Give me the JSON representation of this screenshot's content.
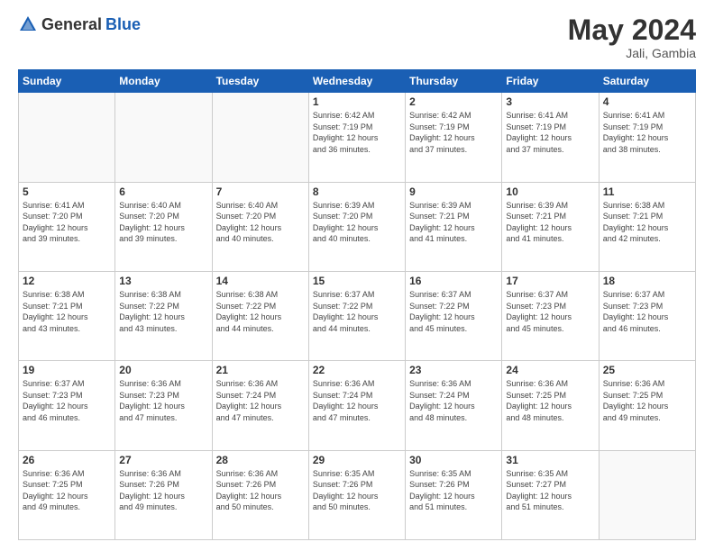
{
  "header": {
    "logo_general": "General",
    "logo_blue": "Blue",
    "month_title": "May 2024",
    "location": "Jali, Gambia"
  },
  "days_of_week": [
    "Sunday",
    "Monday",
    "Tuesday",
    "Wednesday",
    "Thursday",
    "Friday",
    "Saturday"
  ],
  "weeks": [
    [
      {
        "day": "",
        "info": ""
      },
      {
        "day": "",
        "info": ""
      },
      {
        "day": "",
        "info": ""
      },
      {
        "day": "1",
        "info": "Sunrise: 6:42 AM\nSunset: 7:19 PM\nDaylight: 12 hours\nand 36 minutes."
      },
      {
        "day": "2",
        "info": "Sunrise: 6:42 AM\nSunset: 7:19 PM\nDaylight: 12 hours\nand 37 minutes."
      },
      {
        "day": "3",
        "info": "Sunrise: 6:41 AM\nSunset: 7:19 PM\nDaylight: 12 hours\nand 37 minutes."
      },
      {
        "day": "4",
        "info": "Sunrise: 6:41 AM\nSunset: 7:19 PM\nDaylight: 12 hours\nand 38 minutes."
      }
    ],
    [
      {
        "day": "5",
        "info": "Sunrise: 6:41 AM\nSunset: 7:20 PM\nDaylight: 12 hours\nand 39 minutes."
      },
      {
        "day": "6",
        "info": "Sunrise: 6:40 AM\nSunset: 7:20 PM\nDaylight: 12 hours\nand 39 minutes."
      },
      {
        "day": "7",
        "info": "Sunrise: 6:40 AM\nSunset: 7:20 PM\nDaylight: 12 hours\nand 40 minutes."
      },
      {
        "day": "8",
        "info": "Sunrise: 6:39 AM\nSunset: 7:20 PM\nDaylight: 12 hours\nand 40 minutes."
      },
      {
        "day": "9",
        "info": "Sunrise: 6:39 AM\nSunset: 7:21 PM\nDaylight: 12 hours\nand 41 minutes."
      },
      {
        "day": "10",
        "info": "Sunrise: 6:39 AM\nSunset: 7:21 PM\nDaylight: 12 hours\nand 41 minutes."
      },
      {
        "day": "11",
        "info": "Sunrise: 6:38 AM\nSunset: 7:21 PM\nDaylight: 12 hours\nand 42 minutes."
      }
    ],
    [
      {
        "day": "12",
        "info": "Sunrise: 6:38 AM\nSunset: 7:21 PM\nDaylight: 12 hours\nand 43 minutes."
      },
      {
        "day": "13",
        "info": "Sunrise: 6:38 AM\nSunset: 7:22 PM\nDaylight: 12 hours\nand 43 minutes."
      },
      {
        "day": "14",
        "info": "Sunrise: 6:38 AM\nSunset: 7:22 PM\nDaylight: 12 hours\nand 44 minutes."
      },
      {
        "day": "15",
        "info": "Sunrise: 6:37 AM\nSunset: 7:22 PM\nDaylight: 12 hours\nand 44 minutes."
      },
      {
        "day": "16",
        "info": "Sunrise: 6:37 AM\nSunset: 7:22 PM\nDaylight: 12 hours\nand 45 minutes."
      },
      {
        "day": "17",
        "info": "Sunrise: 6:37 AM\nSunset: 7:23 PM\nDaylight: 12 hours\nand 45 minutes."
      },
      {
        "day": "18",
        "info": "Sunrise: 6:37 AM\nSunset: 7:23 PM\nDaylight: 12 hours\nand 46 minutes."
      }
    ],
    [
      {
        "day": "19",
        "info": "Sunrise: 6:37 AM\nSunset: 7:23 PM\nDaylight: 12 hours\nand 46 minutes."
      },
      {
        "day": "20",
        "info": "Sunrise: 6:36 AM\nSunset: 7:23 PM\nDaylight: 12 hours\nand 47 minutes."
      },
      {
        "day": "21",
        "info": "Sunrise: 6:36 AM\nSunset: 7:24 PM\nDaylight: 12 hours\nand 47 minutes."
      },
      {
        "day": "22",
        "info": "Sunrise: 6:36 AM\nSunset: 7:24 PM\nDaylight: 12 hours\nand 47 minutes."
      },
      {
        "day": "23",
        "info": "Sunrise: 6:36 AM\nSunset: 7:24 PM\nDaylight: 12 hours\nand 48 minutes."
      },
      {
        "day": "24",
        "info": "Sunrise: 6:36 AM\nSunset: 7:25 PM\nDaylight: 12 hours\nand 48 minutes."
      },
      {
        "day": "25",
        "info": "Sunrise: 6:36 AM\nSunset: 7:25 PM\nDaylight: 12 hours\nand 49 minutes."
      }
    ],
    [
      {
        "day": "26",
        "info": "Sunrise: 6:36 AM\nSunset: 7:25 PM\nDaylight: 12 hours\nand 49 minutes."
      },
      {
        "day": "27",
        "info": "Sunrise: 6:36 AM\nSunset: 7:26 PM\nDaylight: 12 hours\nand 49 minutes."
      },
      {
        "day": "28",
        "info": "Sunrise: 6:36 AM\nSunset: 7:26 PM\nDaylight: 12 hours\nand 50 minutes."
      },
      {
        "day": "29",
        "info": "Sunrise: 6:35 AM\nSunset: 7:26 PM\nDaylight: 12 hours\nand 50 minutes."
      },
      {
        "day": "30",
        "info": "Sunrise: 6:35 AM\nSunset: 7:26 PM\nDaylight: 12 hours\nand 51 minutes."
      },
      {
        "day": "31",
        "info": "Sunrise: 6:35 AM\nSunset: 7:27 PM\nDaylight: 12 hours\nand 51 minutes."
      },
      {
        "day": "",
        "info": ""
      }
    ]
  ]
}
